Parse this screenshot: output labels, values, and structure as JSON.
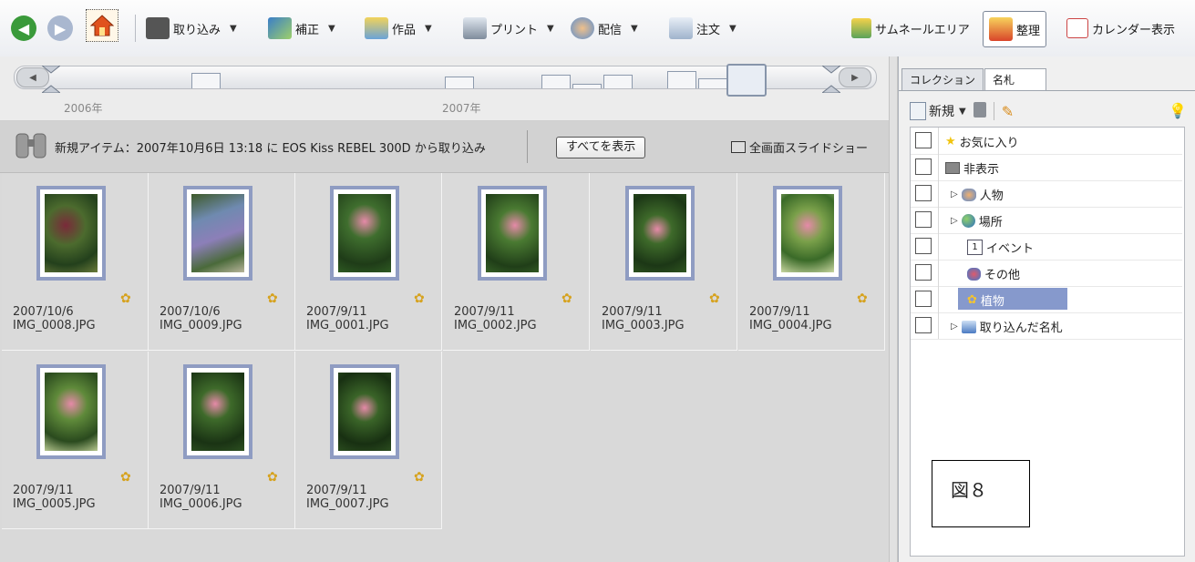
{
  "toolbar": {
    "import_label": "取り込み",
    "correct_label": "補正",
    "works_label": "作品",
    "print_label": "プリント",
    "share_label": "配信",
    "order_label": "注文",
    "thumbnail_area_label": "サムネールエリア",
    "organize_label": "整理",
    "calendar_label": "カレンダー表示"
  },
  "timeline": {
    "year_2006": "2006年",
    "year_2007": "2007年"
  },
  "infobar": {
    "text": "新規アイテム：2007年10月6日 13:18 に EOS Kiss REBEL 300D から取り込み",
    "show_all": "すべてを表示",
    "slideshow": "全画面スライドショー"
  },
  "photos": [
    {
      "date": "2007/10/6",
      "name": "IMG_0008.JPG"
    },
    {
      "date": "2007/10/6",
      "name": "IMG_0009.JPG"
    },
    {
      "date": "2007/9/11",
      "name": "IMG_0001.JPG"
    },
    {
      "date": "2007/9/11",
      "name": "IMG_0002.JPG"
    },
    {
      "date": "2007/9/11",
      "name": "IMG_0003.JPG"
    },
    {
      "date": "2007/9/11",
      "name": "IMG_0004.JPG"
    },
    {
      "date": "2007/9/11",
      "name": "IMG_0005.JPG"
    },
    {
      "date": "2007/9/11",
      "name": "IMG_0006.JPG"
    },
    {
      "date": "2007/9/11",
      "name": "IMG_0007.JPG"
    }
  ],
  "panel": {
    "tabs": [
      "コレクション",
      "名札"
    ],
    "new_label": "新規",
    "tags": [
      {
        "label": "お気に入り"
      },
      {
        "label": "非表示"
      },
      {
        "label": "人物"
      },
      {
        "label": "場所"
      },
      {
        "label": "イベント"
      },
      {
        "label": "その他"
      },
      {
        "label": "植物"
      },
      {
        "label": "取り込んだ名札"
      }
    ]
  },
  "figure_label": "図８",
  "colors": {
    "selection": "#8699cc",
    "frame": "#8f9cc2",
    "star": "#d6a21e"
  }
}
